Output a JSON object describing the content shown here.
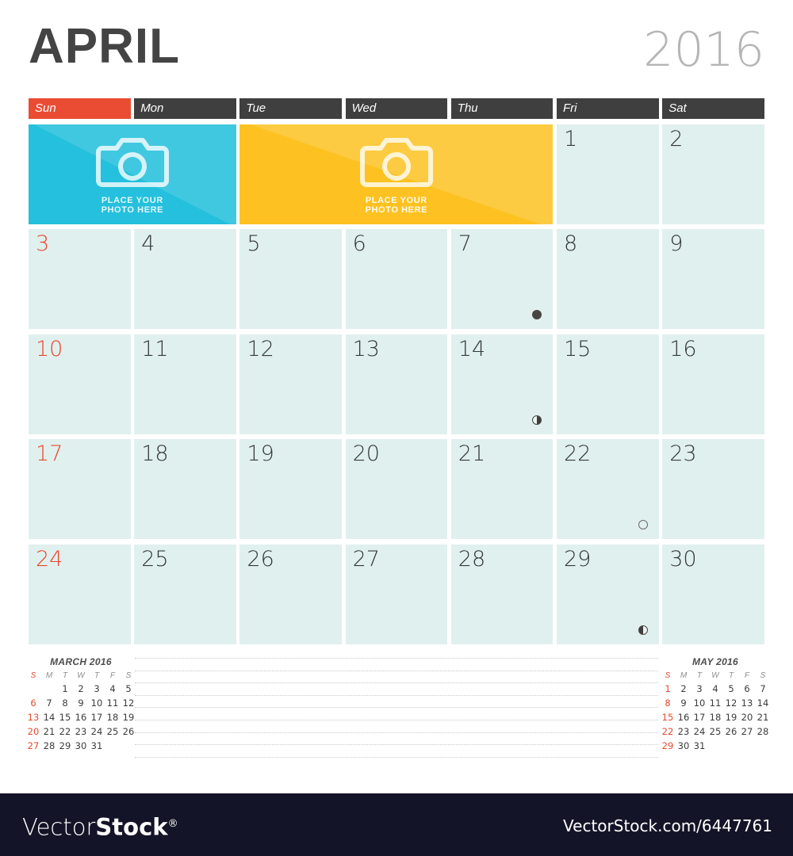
{
  "header": {
    "month": "APRIL",
    "year": "2016"
  },
  "weekdays": [
    {
      "label": "Sun",
      "sunday": true
    },
    {
      "label": "Mon",
      "sunday": false
    },
    {
      "label": "Tue",
      "sunday": false
    },
    {
      "label": "Wed",
      "sunday": false
    },
    {
      "label": "Thu",
      "sunday": false
    },
    {
      "label": "Fri",
      "sunday": false
    },
    {
      "label": "Sat",
      "sunday": false
    }
  ],
  "photos": [
    {
      "id": "photo-cyan",
      "label_line1": "PLACE YOUR",
      "label_line2": "PHOTO HERE",
      "color": "#24c0dd",
      "icon": "camera-icon",
      "col": 0,
      "span": 2
    },
    {
      "id": "photo-yellow",
      "label_line1": "PLACE YOUR",
      "label_line2": "PHOTO HERE",
      "color": "#fdc221",
      "icon": "camera-icon",
      "col": 2,
      "span": 3
    }
  ],
  "grid": {
    "rows": [
      [
        null,
        null,
        null,
        null,
        null,
        {
          "day": "1"
        },
        {
          "day": "2"
        }
      ],
      [
        {
          "day": "3",
          "sunday": true
        },
        {
          "day": "4"
        },
        {
          "day": "5"
        },
        {
          "day": "6"
        },
        {
          "day": "7",
          "moon": "new-moon"
        },
        {
          "day": "8"
        },
        {
          "day": "9"
        }
      ],
      [
        {
          "day": "10",
          "sunday": true
        },
        {
          "day": "11"
        },
        {
          "day": "12"
        },
        {
          "day": "13"
        },
        {
          "day": "14",
          "moon": "first-quarter-moon"
        },
        {
          "day": "15"
        },
        {
          "day": "16"
        }
      ],
      [
        {
          "day": "17",
          "sunday": true
        },
        {
          "day": "18"
        },
        {
          "day": "19"
        },
        {
          "day": "20"
        },
        {
          "day": "21"
        },
        {
          "day": "22",
          "moon": "full-moon"
        },
        {
          "day": "23"
        }
      ],
      [
        {
          "day": "24",
          "sunday": true
        },
        {
          "day": "25"
        },
        {
          "day": "26"
        },
        {
          "day": "27"
        },
        {
          "day": "28"
        },
        {
          "day": "29",
          "moon": "last-quarter-moon"
        },
        {
          "day": "30"
        }
      ]
    ]
  },
  "mini_calendars": [
    {
      "title": "MARCH 2016",
      "weekday_initials": [
        "S",
        "M",
        "T",
        "W",
        "T",
        "F",
        "S"
      ],
      "weeks": [
        [
          "",
          "",
          "1",
          "2",
          "3",
          "4",
          "5"
        ],
        [
          "6",
          "7",
          "8",
          "9",
          "10",
          "11",
          "12"
        ],
        [
          "13",
          "14",
          "15",
          "16",
          "17",
          "18",
          "19"
        ],
        [
          "20",
          "21",
          "22",
          "23",
          "24",
          "25",
          "26"
        ],
        [
          "27",
          "28",
          "29",
          "30",
          "31",
          "",
          ""
        ]
      ]
    },
    {
      "title": "MAY 2016",
      "weekday_initials": [
        "S",
        "M",
        "T",
        "W",
        "T",
        "F",
        "S"
      ],
      "weeks": [
        [
          "1",
          "2",
          "3",
          "4",
          "5",
          "6",
          "7"
        ],
        [
          "8",
          "9",
          "10",
          "11",
          "12",
          "13",
          "14"
        ],
        [
          "15",
          "16",
          "17",
          "18",
          "19",
          "20",
          "21"
        ],
        [
          "22",
          "23",
          "24",
          "25",
          "26",
          "27",
          "28"
        ],
        [
          "29",
          "30",
          "31",
          "",
          "",
          "",
          ""
        ]
      ]
    }
  ],
  "notes": {
    "line_count": 9
  },
  "footer": {
    "logo_light": "Vector",
    "logo_bold": "Stock",
    "logo_reg": "®",
    "url": "VectorStock.com/6447761"
  },
  "colors": {
    "sunday_accent": "#ea4c33",
    "weekday_header": "#3f3f3f",
    "cell_bg": "#e0f0ee",
    "photo_cyan": "#24c0dd",
    "photo_yellow": "#fdc221",
    "footer_bg": "#141428",
    "year_gray": "#b5b5b5"
  }
}
